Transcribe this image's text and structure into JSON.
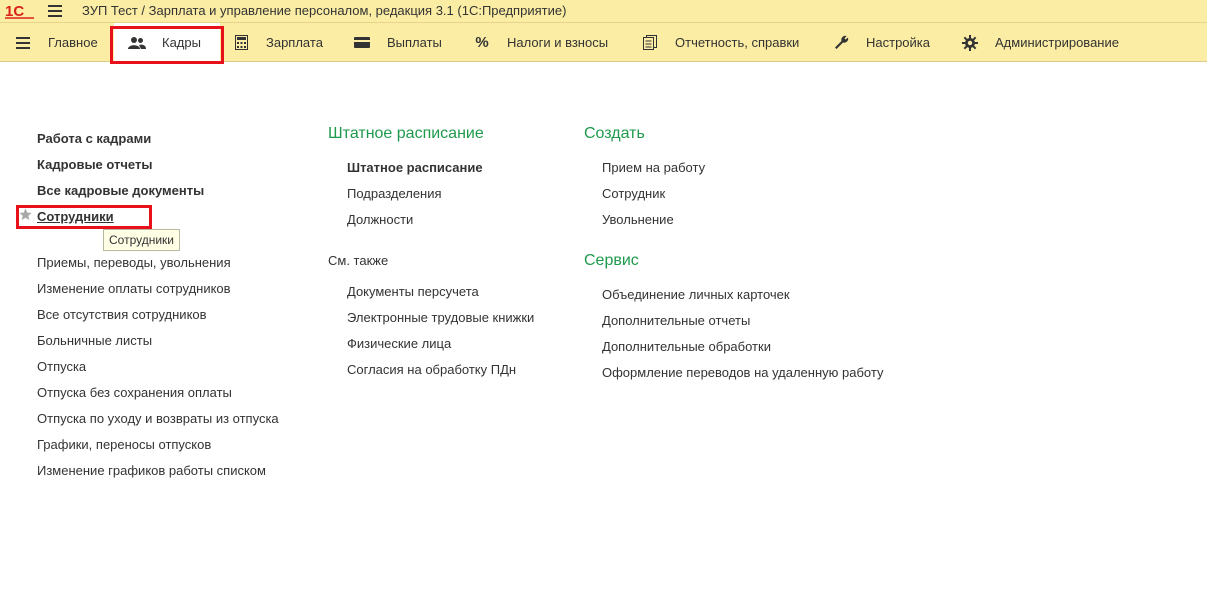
{
  "window": {
    "title": "ЗУП Тест / Зарплата и управление персоналом, редакция 3.1  (1С:Предприятие)"
  },
  "logo": {
    "text": "1С"
  },
  "colors": {
    "panel": "#fbeda4",
    "accent_green": "#1f9a4c",
    "highlight": "#e8101b"
  },
  "sections": [
    {
      "label": "Главное",
      "icon": "menu-icon"
    },
    {
      "label": "Кадры",
      "icon": "people-icon",
      "active": true
    },
    {
      "label": "Зарплата",
      "icon": "calculator-icon"
    },
    {
      "label": "Выплаты",
      "icon": "wallet-icon"
    },
    {
      "label": "Налоги и взносы",
      "icon": "percent-icon"
    },
    {
      "label": "Отчетность, справки",
      "icon": "reports-icon"
    },
    {
      "label": "Настройка",
      "icon": "wrench-icon"
    },
    {
      "label": "Администрирование",
      "icon": "gear-icon"
    }
  ],
  "left_column": {
    "bold_items": [
      "Работа с кадрами",
      "Кадровые отчеты",
      "Все кадровые документы"
    ],
    "favorite_item": "Сотрудники",
    "tooltip": "Сотрудники",
    "items": [
      "Приемы, переводы, увольнения",
      "Изменение оплаты сотрудников",
      "Все отсутствия сотрудников",
      "Больничные листы",
      "Отпуска",
      "Отпуска без сохранения оплаты",
      "Отпуска по уходу и возвраты из отпуска",
      "Графики, переносы отпусков",
      "Изменение графиков работы списком"
    ]
  },
  "middle_column": {
    "group_title": "Штатное расписание",
    "group_items": [
      "Штатное расписание",
      "Подразделения",
      "Должности"
    ],
    "see_also_title": "См. также",
    "see_also_items": [
      "Документы персучета",
      "Электронные трудовые книжки",
      "Физические лица",
      "Согласия на обработку ПДн"
    ]
  },
  "right_column": {
    "create_title": "Создать",
    "create_items": [
      "Прием на работу",
      "Сотрудник",
      "Увольнение"
    ],
    "service_title": "Сервис",
    "service_items": [
      "Объединение личных карточек",
      "Дополнительные отчеты",
      "Дополнительные обработки",
      "Оформление переводов на удаленную работу"
    ]
  }
}
